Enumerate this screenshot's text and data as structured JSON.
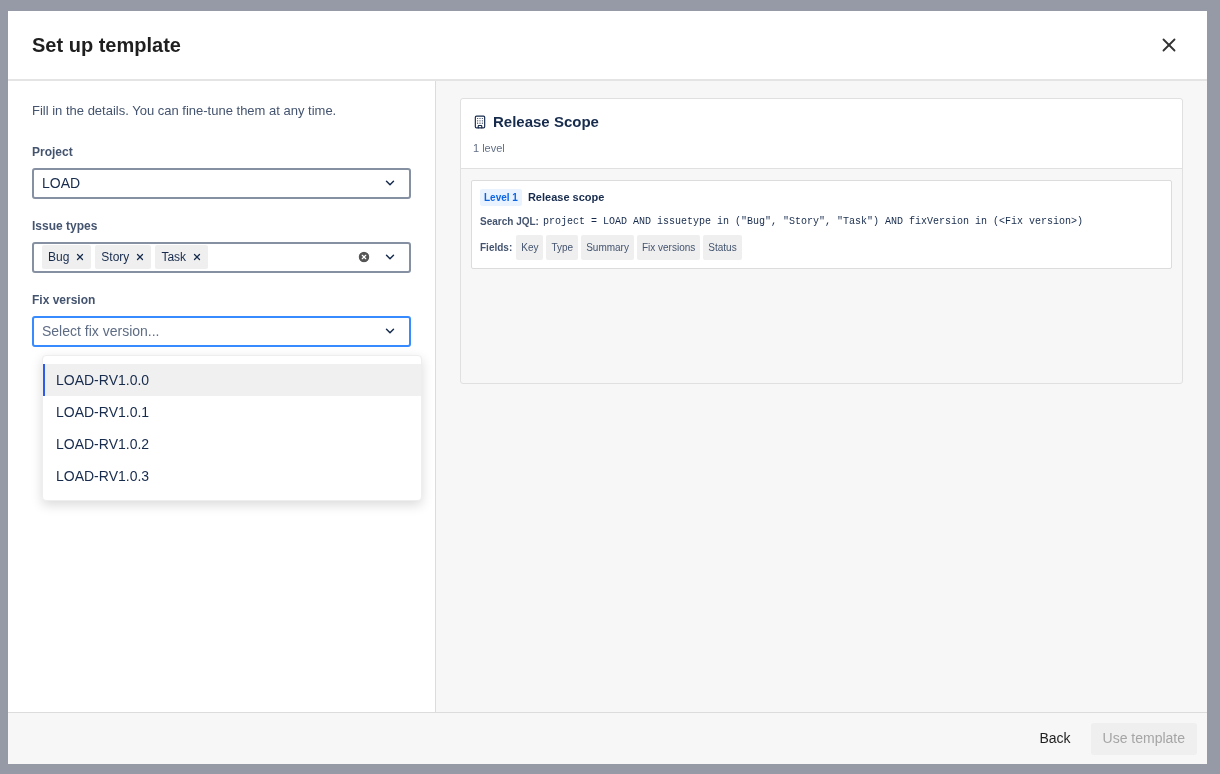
{
  "dialog": {
    "title": "Set up template",
    "intro": "Fill in the details. You can fine-tune them at any time.",
    "project": {
      "label": "Project",
      "value": "LOAD"
    },
    "issue_types": {
      "label": "Issue types",
      "tags": [
        "Bug",
        "Story",
        "Task"
      ]
    },
    "fix_version": {
      "label": "Fix version",
      "placeholder": "Select fix version...",
      "focused": true,
      "options": [
        {
          "label": "LOAD-RV1.0.0",
          "selected": true
        },
        {
          "label": "LOAD-RV1.0.1",
          "selected": false
        },
        {
          "label": "LOAD-RV1.0.2",
          "selected": false
        },
        {
          "label": "LOAD-RV1.0.3",
          "selected": false
        }
      ]
    },
    "preview": {
      "title": "Release Scope",
      "subtitle": "1 level",
      "levels": [
        {
          "badge": "Level 1",
          "name": "Release scope",
          "jql_label": "Search JQL:",
          "jql": "project = LOAD AND issuetype in (\"Bug\", \"Story\", \"Task\") AND fixVersion in (<Fix version>)",
          "fields_label": "Fields:",
          "fields": [
            "Key",
            "Type",
            "Summary",
            "Fix versions",
            "Status"
          ]
        }
      ]
    },
    "footer": {
      "back": "Back",
      "use_template": {
        "label": "Use template",
        "disabled": true
      }
    }
  }
}
